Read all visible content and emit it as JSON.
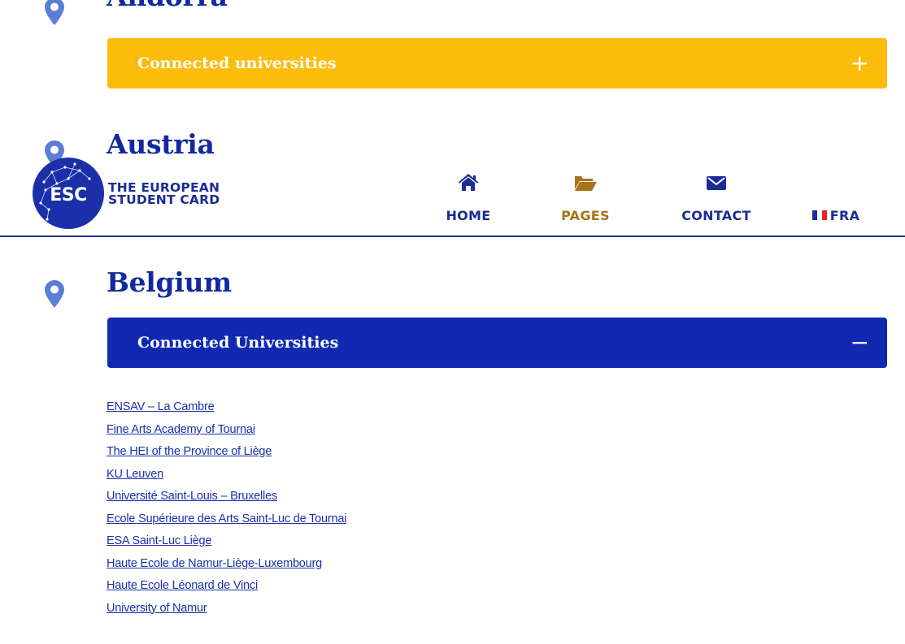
{
  "sections": {
    "andorra": {
      "title": "Andorra",
      "accordion_label": "Connected universities",
      "toggle": "+"
    },
    "austria": {
      "title": "Austria"
    },
    "belgium": {
      "title": "Belgium",
      "accordion_label": "Connected Universities",
      "toggle": "−",
      "universities": [
        "ENSAV – La Cambre",
        "Fine Arts Academy of Tournai",
        "The HEI of the Province of Liège",
        "KU Leuven",
        "Université Saint-Louis – Bruxelles",
        "Ecole Supérieure des Arts Saint-Luc de Tournai",
        "ESA Saint-Luc Liège",
        "Haute Ecole de Namur-Liège-Luxembourg",
        "Haute Ecole Léonard de Vinci",
        "University of Namur"
      ]
    }
  },
  "header": {
    "logo_abbr": "ESC",
    "logo_line1": "THE EUROPEAN",
    "logo_line2": "STUDENT CARD",
    "nav": {
      "home": "HOME",
      "pages": "PAGES",
      "contact": "CONTACT",
      "language": "FRA"
    },
    "icons": {
      "home": "home-icon",
      "pages": "folder-open-icon",
      "contact": "envelope-icon",
      "language": "french-flag-icon"
    }
  },
  "colors": {
    "brand_blue": "#1029b0",
    "accent_yellow": "#fbbc0b",
    "active_nav": "#a8731a",
    "pin": "#5b7fd6"
  }
}
